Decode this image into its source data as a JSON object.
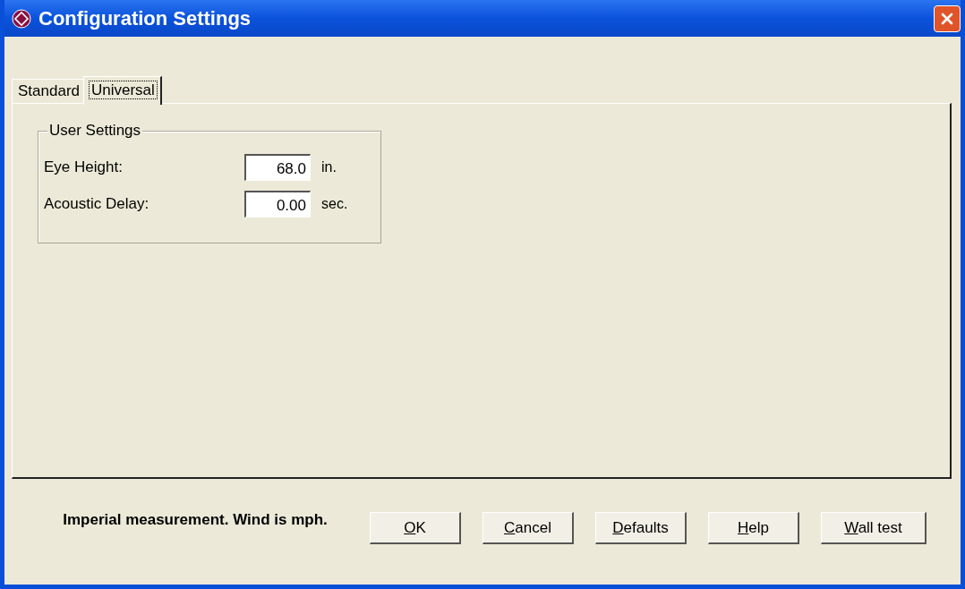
{
  "window": {
    "title": "Configuration Settings"
  },
  "tabs": [
    {
      "label": "Standard",
      "selected": false
    },
    {
      "label": "Universal",
      "selected": true
    }
  ],
  "group": {
    "title": "User Settings",
    "fields": [
      {
        "label": "Eye Height:",
        "value": "68.0",
        "unit": "in."
      },
      {
        "label": "Acoustic Delay:",
        "value": "0.00",
        "unit": "sec."
      }
    ]
  },
  "status_text": "Imperial measurement. Wind is mph.",
  "buttons": [
    {
      "accel": "O",
      "rest": "K"
    },
    {
      "accel": "C",
      "rest": "ancel"
    },
    {
      "accel": "D",
      "rest": "efaults"
    },
    {
      "accel": "H",
      "rest": "elp"
    },
    {
      "accel": "W",
      "rest": "all test"
    }
  ]
}
